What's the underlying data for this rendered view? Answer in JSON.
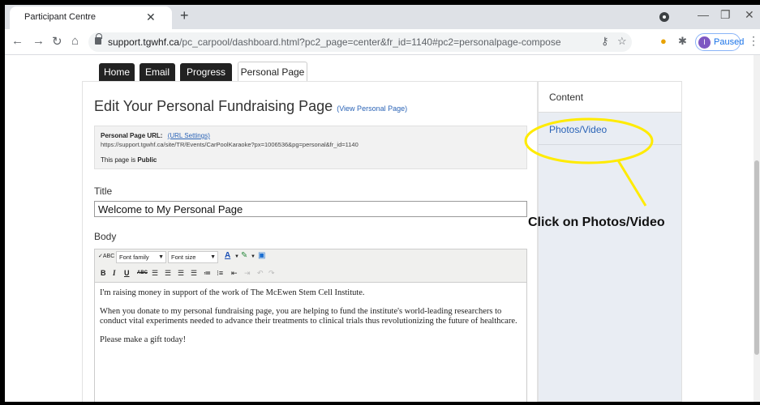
{
  "browser": {
    "tab_title": "Participant Centre",
    "url_domain": "support.tgwhf.ca",
    "url_path": "/pc_carpool/dashboard.html?pc2_page=center&fr_id=1140#pc2=personalpage-compose",
    "profile_initial": "I",
    "profile_status": "Paused"
  },
  "nav": {
    "tabs": [
      "Home",
      "Email",
      "Progress",
      "Personal Page"
    ]
  },
  "main": {
    "heading": "Edit Your Personal Fundraising Page",
    "view_link": "(View Personal Page)",
    "url_label": "Personal Page URL:",
    "url_settings": "(URL Settings)",
    "page_url": "https://support.tgwhf.ca/site/TR/Events/CarPoolKaraoke?px=1006536&pg=personal&fr_id=1140",
    "public_prefix": "This page is",
    "public_value": "Public",
    "title_label": "Title",
    "title_value": "Welcome to My Personal Page",
    "body_label": "Body"
  },
  "editor": {
    "font_family": "Font family",
    "font_size": "Font size",
    "paragraphs": [
      "I'm raising money in support of the work of The McEwen Stem Cell Institute.",
      "When you donate to my personal fundraising page, you are helping to fund the institute's world-leading researchers to conduct vital experiments needed to advance their treatments to clinical trials thus revolutionizing the future of healthcare.",
      "Please make a gift today!"
    ]
  },
  "side": {
    "content": "Content",
    "photos": "Photos/Video"
  },
  "annotation": {
    "text": "Click on Photos/Video",
    "color": "#ffeb00"
  }
}
